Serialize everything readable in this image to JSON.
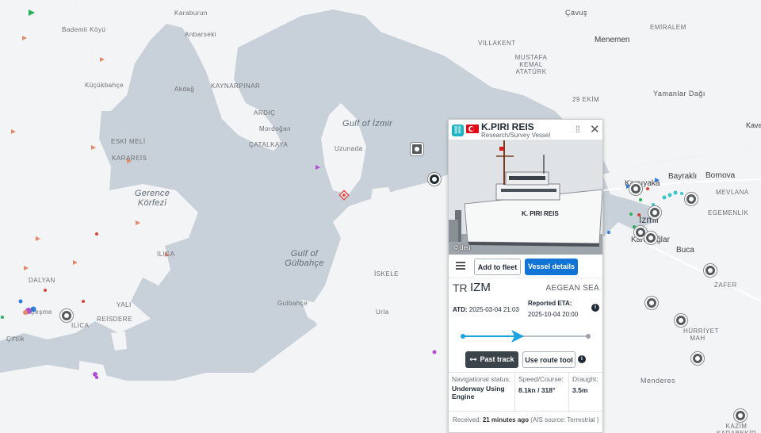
{
  "map": {
    "places": [
      {
        "name": "Karaburun",
        "kind": "small"
      },
      {
        "name": "Bademli Köyü",
        "kind": "small"
      },
      {
        "name": "Anbarseki",
        "kind": "small"
      },
      {
        "name": "Küçükbahçe",
        "kind": "small"
      },
      {
        "name": "Akdağ",
        "kind": "small"
      },
      {
        "name": "KAYNARPINAR",
        "kind": "small"
      },
      {
        "name": "ARDIÇ",
        "kind": "small"
      },
      {
        "name": "Mordoğan",
        "kind": "small"
      },
      {
        "name": "ÇATALKAYA",
        "kind": "small"
      },
      {
        "name": "ESKİ MELİ",
        "kind": "small"
      },
      {
        "name": "KARAREİS",
        "kind": "small"
      },
      {
        "name": "Gulf of İzmir",
        "kind": "water"
      },
      {
        "name": "Uzunada",
        "kind": "small"
      },
      {
        "name": "Gerence Körfezi",
        "kind": "water"
      },
      {
        "name": "Gulf of Gülbahçe",
        "kind": "water"
      },
      {
        "name": "DALYAN",
        "kind": "small"
      },
      {
        "name": "ILICA",
        "kind": "small"
      },
      {
        "name": "Gulbahçe",
        "kind": "small"
      },
      {
        "name": "Urla",
        "kind": "small"
      },
      {
        "name": "İSKELE",
        "kind": "small"
      },
      {
        "name": "Çeşme",
        "kind": "small"
      },
      {
        "name": "Çiftlik",
        "kind": "small"
      },
      {
        "name": "REİSDERE",
        "kind": "small"
      },
      {
        "name": "YALI",
        "kind": "small"
      },
      {
        "name": "İLICA",
        "kind": "small"
      },
      {
        "name": "VİLLAKENT",
        "kind": "small"
      },
      {
        "name": "MUSTAFA KEMAL ATATÜRK",
        "kind": "small"
      },
      {
        "name": "Menemen",
        "kind": "city"
      },
      {
        "name": "Çavuş",
        "kind": "small"
      },
      {
        "name": "EMİRALEM",
        "kind": "small"
      },
      {
        "name": "29 EKİM",
        "kind": "small"
      },
      {
        "name": "Yamanlar Dağı",
        "kind": "small"
      },
      {
        "name": "Bayraklı",
        "kind": "city"
      },
      {
        "name": "Bornova",
        "kind": "city"
      },
      {
        "name": "Karşıyaka",
        "kind": "city"
      },
      {
        "name": "MEVLANA",
        "kind": "small"
      },
      {
        "name": "EGEMENLİK",
        "kind": "small"
      },
      {
        "name": "İzmir",
        "kind": "city"
      },
      {
        "name": "Karabağlar",
        "kind": "city"
      },
      {
        "name": "Buca",
        "kind": "city"
      },
      {
        "name": "ZAFER",
        "kind": "small"
      },
      {
        "name": "HÜRRİYET MAH",
        "kind": "small"
      },
      {
        "name": "Menderes",
        "kind": "small"
      },
      {
        "name": "KAZIM KARABEKİR",
        "kind": "small"
      },
      {
        "name": "Kavak",
        "kind": "small"
      }
    ]
  },
  "panel": {
    "vessel_name": "K.PIRI REIS",
    "vessel_type": "Research/Survey Vessel",
    "photo_credit": "© deu",
    "ship_hull_text": "K. PIRI REIS",
    "add_to_fleet": "Add to fleet",
    "vessel_details": "Vessel details",
    "flag_code": "TR",
    "port": "IZM",
    "area": "AEGEAN SEA",
    "atd_label": "ATD:",
    "atd_value": "2025-03-04 21:03",
    "eta_label": "Reported ETA:",
    "eta_value": "2025-10-04 20:00",
    "past_track": "Past track",
    "use_route_tool": "Use route tool",
    "nav_status_label": "Navigational status:",
    "nav_status_value": "Underway Using Engine",
    "speed_label": "Speed/Course:",
    "speed_value": "8.1kn / 318°",
    "draught_label": "Draught:",
    "draught_value": "3.5m",
    "received_label": "Received:",
    "received_value": "21 minutes ago",
    "received_source": "(AIS source: Terrestrial )",
    "progress": 0.45,
    "colors": {
      "accent": "#1275d6",
      "progress": "#1ba3e0",
      "flag": "#e30a17",
      "link": "#1bb3c2"
    }
  }
}
